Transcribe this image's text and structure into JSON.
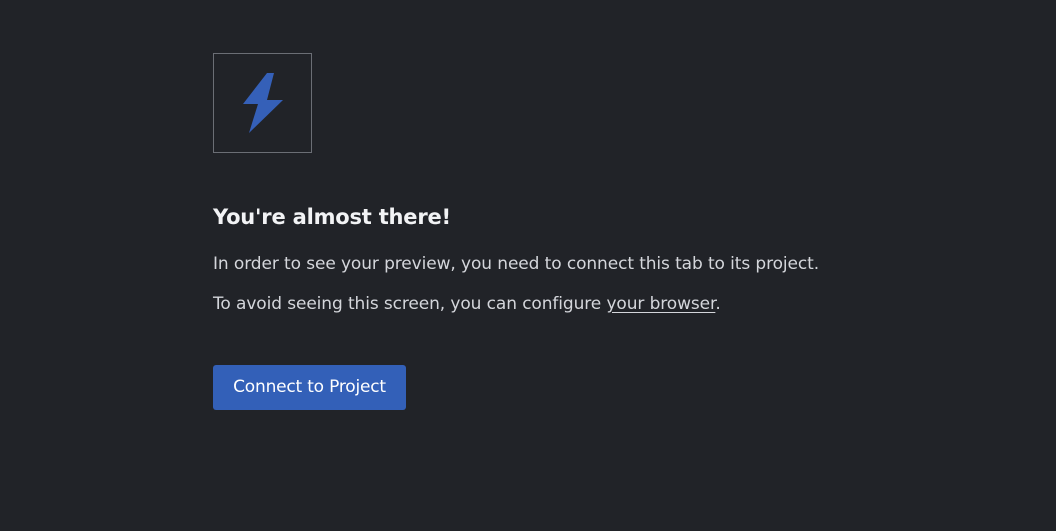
{
  "logo": {
    "icon": "lightning-bolt-icon",
    "color": "#3560b8"
  },
  "heading": "You're almost there!",
  "paragraph1": "In order to see your preview, you need to connect this tab to its project.",
  "paragraph2": {
    "prefix": "To avoid seeing this screen, you can configure ",
    "link_text": "your browser",
    "suffix": "."
  },
  "button": {
    "label": "Connect to Project",
    "color": "#3360b8"
  },
  "colors": {
    "background": "#212328",
    "text": "#d4d6db",
    "heading": "#f2f3f5"
  }
}
